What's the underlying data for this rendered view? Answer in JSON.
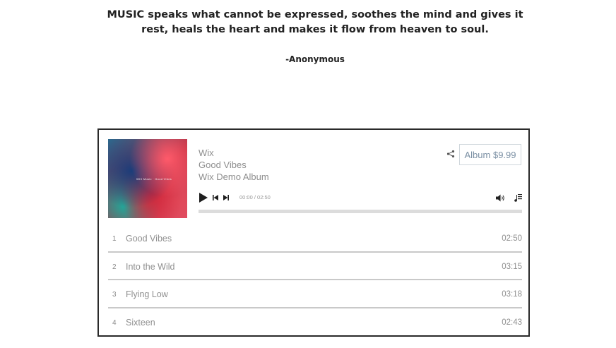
{
  "quote": {
    "text": "MUSIC speaks what cannot be expressed, soothes the mind and gives it rest, heals the heart and makes it flow from heaven to soul.",
    "author": "-Anonymous"
  },
  "player": {
    "cover_text": "WIX Music · Good Vibes",
    "artist": "Wix",
    "track_title": "Good Vibes",
    "album_name": "Wix Demo Album",
    "buy_label": "Album $9.99",
    "time_label": "00:00 / 02:50",
    "progress": 0,
    "icons": {
      "share": "share-icon",
      "play": "play-icon",
      "prev": "skip-back-icon",
      "next": "skip-forward-icon",
      "volume": "volume-icon",
      "playlist": "playlist-icon"
    },
    "colors": {
      "border": "#2a2a2a",
      "text_muted": "#8f8f8f",
      "buy_text": "#7a8fa3",
      "progress_track": "#dcdcdc"
    }
  },
  "tracks": [
    {
      "num": "1",
      "title": "Good Vibes",
      "duration": "02:50"
    },
    {
      "num": "2",
      "title": "Into the Wild",
      "duration": "03:15"
    },
    {
      "num": "3",
      "title": "Flying Low",
      "duration": "03:18"
    },
    {
      "num": "4",
      "title": "Sixteen",
      "duration": "02:43"
    }
  ]
}
